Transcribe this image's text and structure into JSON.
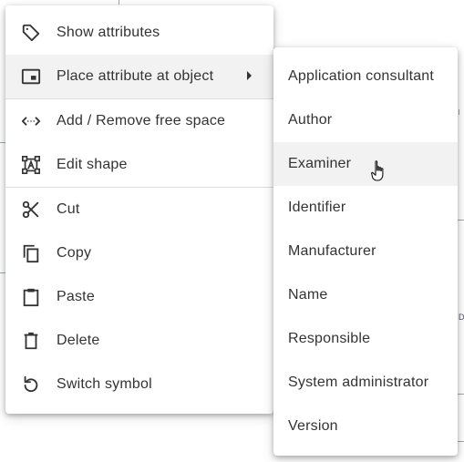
{
  "context_menu": {
    "items": [
      {
        "label": "Show attributes",
        "icon": "tag-icon"
      },
      {
        "label": "Place attribute at object",
        "icon": "picture-in-picture-icon",
        "has_submenu": true
      },
      {
        "label": "Add / Remove free space",
        "icon": "expand-horizontal-icon"
      },
      {
        "label": "Edit shape",
        "icon": "edit-shape-icon"
      },
      {
        "label": "Cut",
        "icon": "scissors-icon"
      },
      {
        "label": "Copy",
        "icon": "copy-icon"
      },
      {
        "label": "Paste",
        "icon": "clipboard-icon"
      },
      {
        "label": "Delete",
        "icon": "trash-icon"
      },
      {
        "label": "Switch symbol",
        "icon": "rotate-ccw-icon"
      }
    ]
  },
  "submenu": {
    "items": [
      {
        "label": "Application consultant"
      },
      {
        "label": "Author"
      },
      {
        "label": "Examiner",
        "hovered": true
      },
      {
        "label": "Identifier"
      },
      {
        "label": "Manufacturer"
      },
      {
        "label": "Name"
      },
      {
        "label": "Responsible"
      },
      {
        "label": "System administrator"
      },
      {
        "label": "Version"
      }
    ]
  },
  "background": {
    "fragment_text": "D"
  },
  "colors": {
    "text": "#333333",
    "hover": "#f2f2f2",
    "divider": "#dcdcdc",
    "menu_bg": "#ffffff"
  }
}
